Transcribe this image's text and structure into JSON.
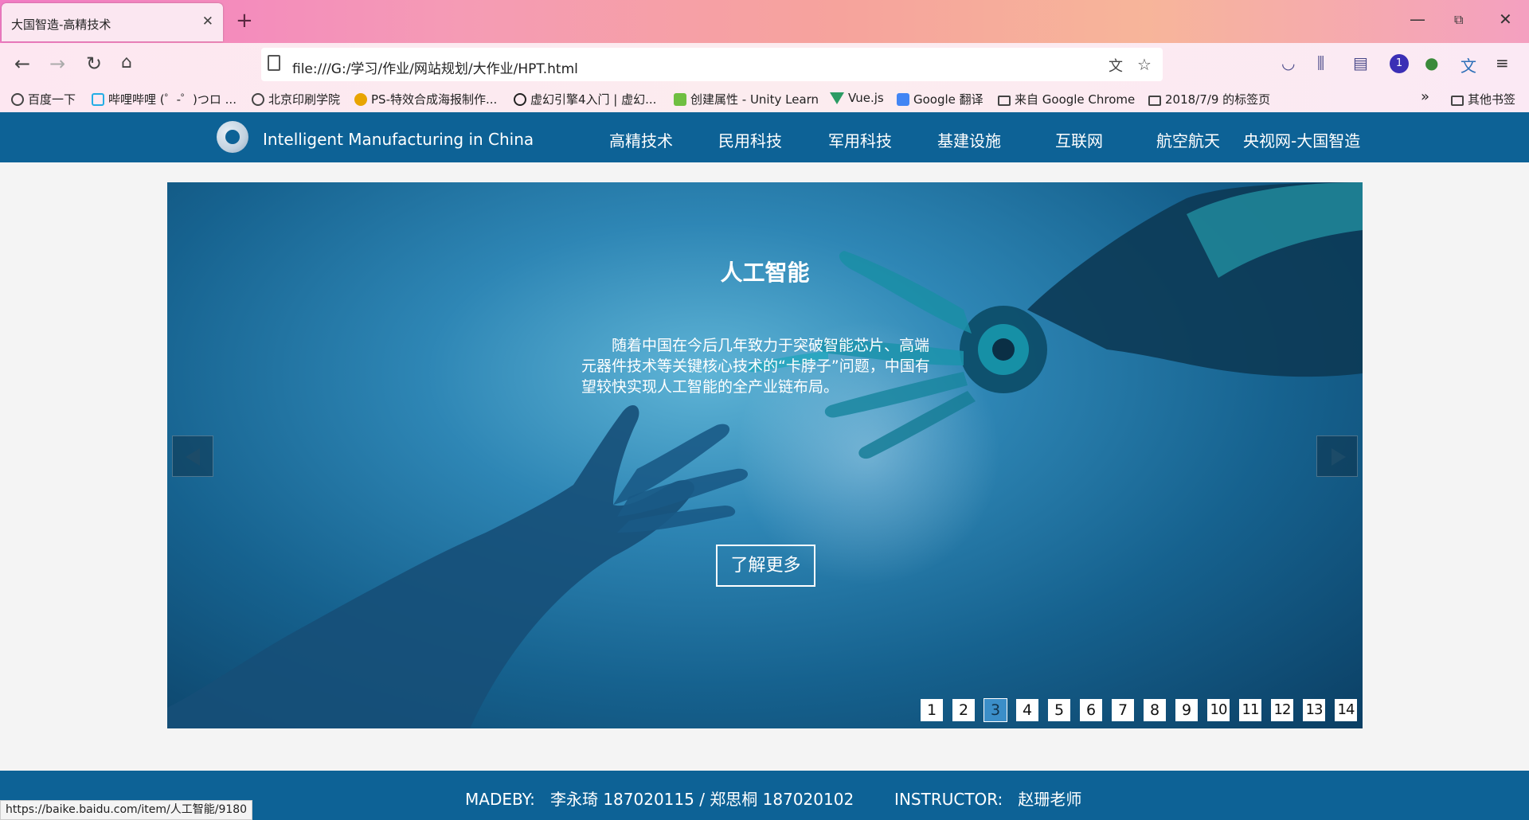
{
  "browser": {
    "tab_title": "大国智造-高精技术",
    "tab_close": "✕",
    "new_tab": "+",
    "url": "file:///G:/学习/作业/网站规划/大作业/HPT.html",
    "window_controls": {
      "minimize": "—",
      "restore": "⧉",
      "close": "✕"
    },
    "badge_count": "1",
    "bookmarks": [
      "百度一下",
      "哔哩哔哩 (゜-゜)つロ ...",
      "北京印刷学院",
      "PS-特效合成海报制作...",
      "虚幻引擎4入门 | 虚幻...",
      "创建属性 - Unity Learn",
      "Vue.js",
      "Google 翻译",
      "来自 Google Chrome",
      "2018/7/9 的标签页",
      "其他书签"
    ],
    "bookmarks_overflow": "»",
    "status_url": "https://baike.baidu.com/item/人工智能/9180"
  },
  "site": {
    "title": "Intelligent Manufacturing in China",
    "menu": [
      "高精技术",
      "民用科技",
      "军用科技",
      "基建设施",
      "互联网",
      "航空航天",
      "央视网-大国智造"
    ]
  },
  "hero": {
    "title": "人工智能",
    "description": "随着中国在今后几年致力于突破智能芯片、高端元器件技术等关键核心技术的“卡脖子”问题，中国有望较快实现人工智能的全产业链布局。",
    "button": "了解更多",
    "pages": [
      "1",
      "2",
      "3",
      "4",
      "5",
      "6",
      "7",
      "8",
      "9",
      "10",
      "11",
      "12",
      "13",
      "14"
    ],
    "active_page": "3"
  },
  "footer": {
    "text": "MADEBY:   李永琦 187020115 / 郑思桐 187020102        INSTRUCTOR:   赵珊老师"
  },
  "colors": {
    "header_bg": "#0d6296",
    "active_page": "#3b8ec8"
  }
}
